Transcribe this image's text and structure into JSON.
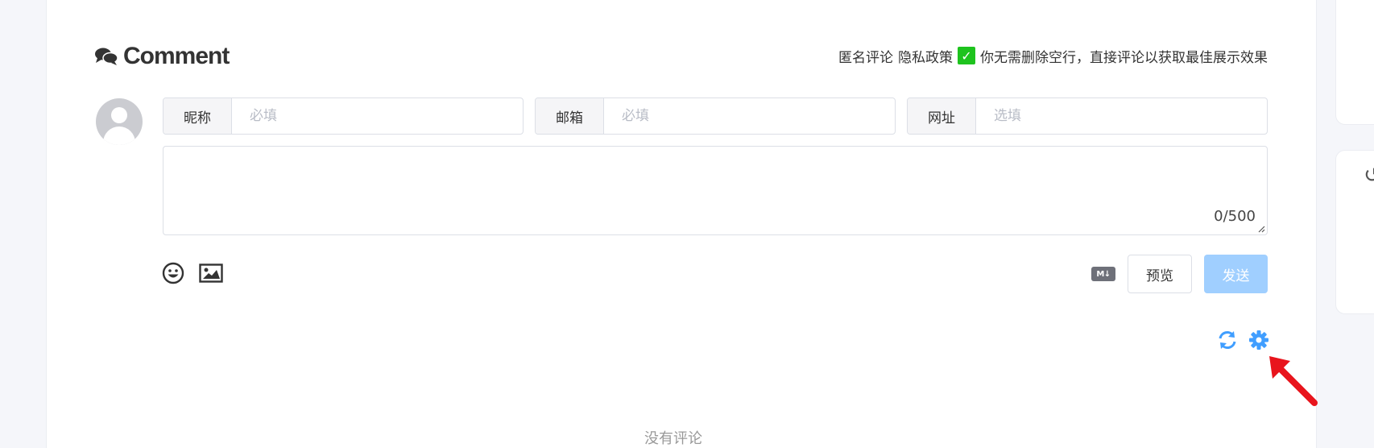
{
  "comment_section": {
    "title": "Comment",
    "notice": {
      "anonymous": "匿名评论",
      "privacy": "隐私政策",
      "tip": "你无需删除空行，直接评论以获取最佳展示效果"
    }
  },
  "form": {
    "nickname": {
      "label": "昵称",
      "placeholder": "必填",
      "value": ""
    },
    "email": {
      "label": "邮箱",
      "placeholder": "必填",
      "value": ""
    },
    "website": {
      "label": "网址",
      "placeholder": "选填",
      "value": ""
    },
    "textarea": {
      "value": "",
      "counter": "0/500"
    },
    "markdown_badge": "M↓",
    "preview_label": "预览",
    "send_label": "发送"
  },
  "footer": {
    "empty_text": "没有评论"
  },
  "colors": {
    "accent": "#409eff",
    "send_disabled": "#a0cfff",
    "check_green": "#1ec31e",
    "arrow_red": "#e8141c"
  },
  "icons": [
    "comments-icon",
    "check-icon",
    "avatar-icon",
    "emoji-icon",
    "image-icon",
    "markdown-icon",
    "refresh-icon",
    "gear-icon",
    "annotation-arrow"
  ]
}
